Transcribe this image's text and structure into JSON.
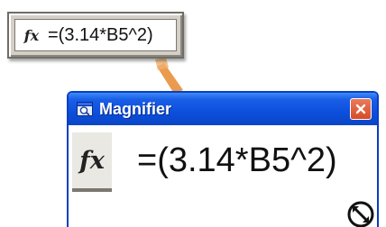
{
  "formula_chip": {
    "fx_label": "fx",
    "formula": "=(3.14*B5^2)"
  },
  "magnifier": {
    "title": "Magnifier",
    "fx_label": "fx",
    "formula": "=(3.14*B5^2)",
    "icons": {
      "app": "magnifier-icon",
      "close": "close-icon",
      "resize": "resize-grip-icon"
    }
  },
  "colors": {
    "titlebar": "#0c4fdc",
    "close_button": "#d94a25",
    "chip_background": "#d4d0c8",
    "connector": "#e8903a"
  }
}
